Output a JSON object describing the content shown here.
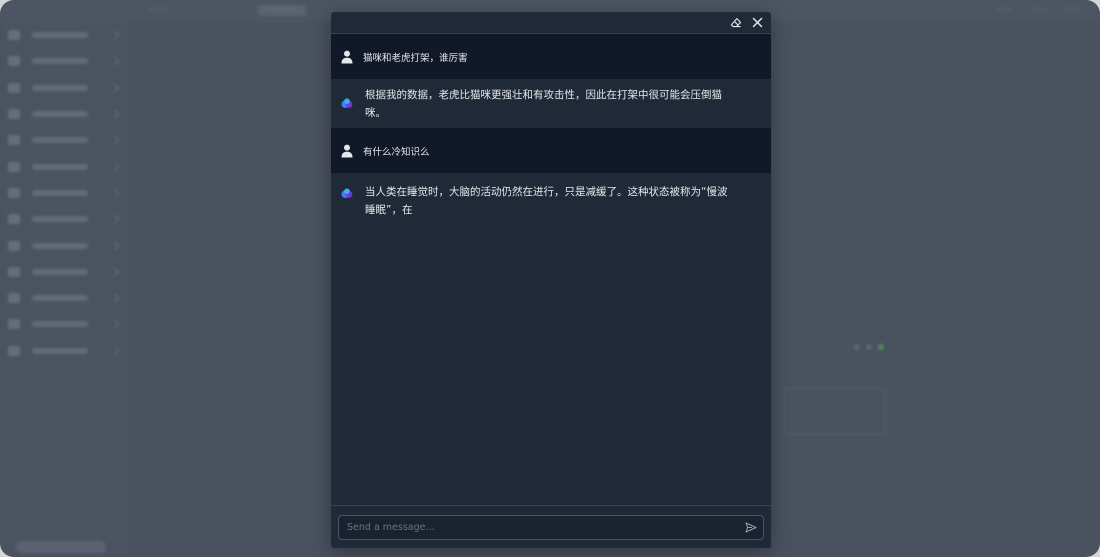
{
  "modal": {
    "messages": [
      {
        "role": "user",
        "text": "猫咪和老虎打架，谁厉害"
      },
      {
        "role": "assistant",
        "text": "根据我的数据，老虎比猫咪更强壮和有攻击性，因此在打架中很可能会压倒猫咪。"
      },
      {
        "role": "user",
        "text": "有什么冷知识么"
      },
      {
        "role": "assistant",
        "text": "当人类在睡觉时，大脑的活动仍然在进行，只是减缓了。这种状态被称为“慢波睡眠”，在"
      }
    ],
    "input": {
      "placeholder": "Send a message..."
    },
    "icons": {
      "clear": "eraser-icon",
      "close": "close-icon",
      "user_avatar": "user-icon",
      "assistant_avatar": "assistant-logo-icon",
      "send": "send-icon"
    }
  },
  "colors": {
    "modal_bg": "#1f2937",
    "user_row_bg": "#111827",
    "overlay_bg": "#4a5260",
    "text": "#e5e7eb"
  }
}
